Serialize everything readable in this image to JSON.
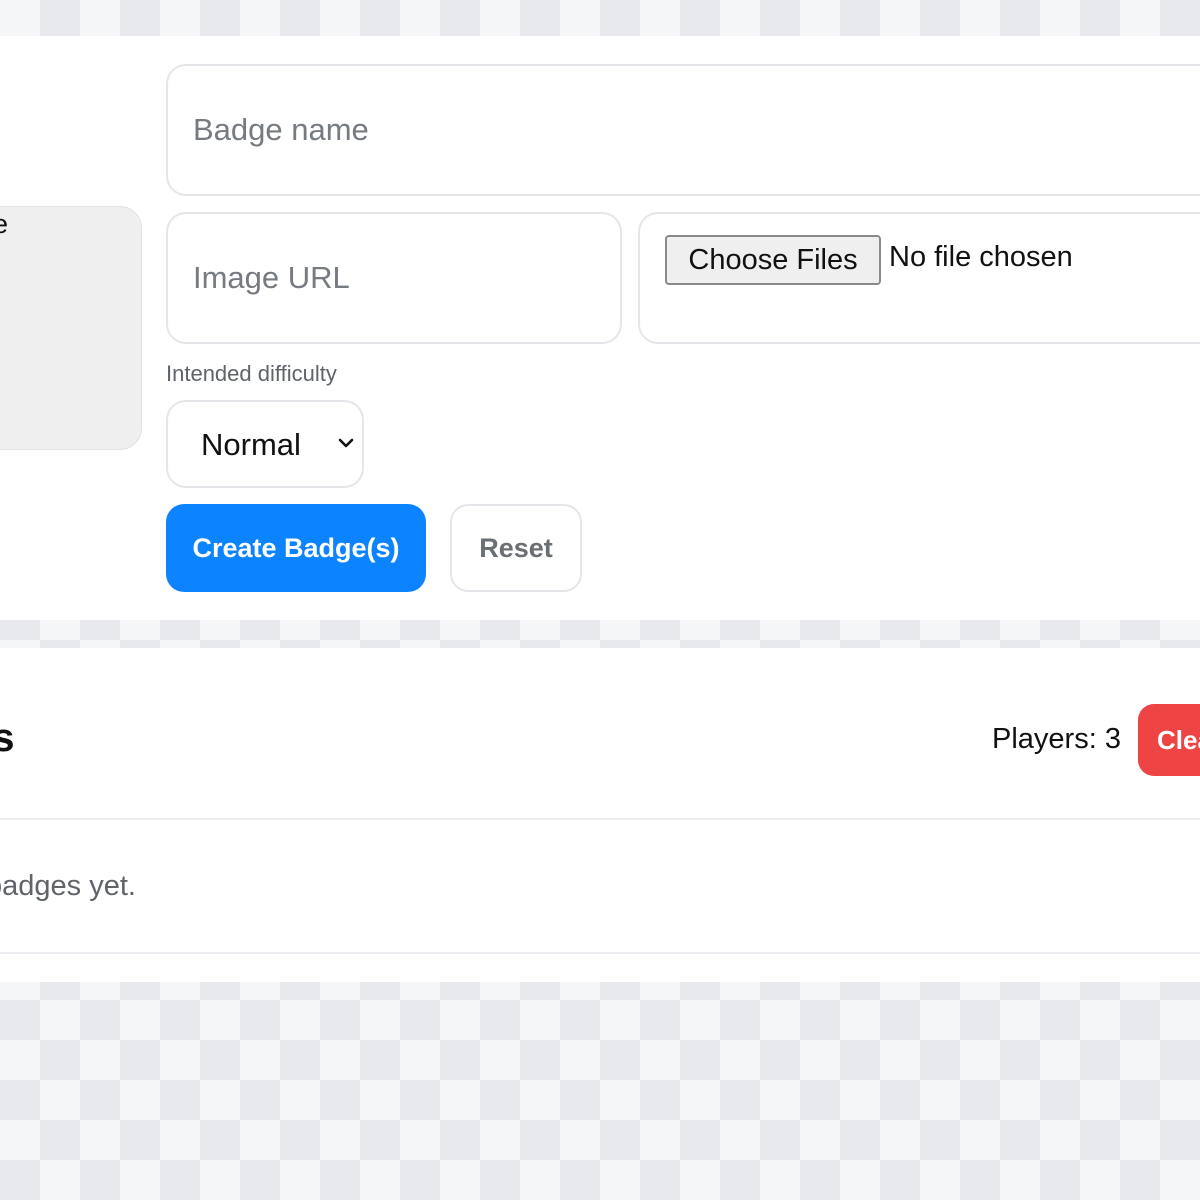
{
  "badge_form": {
    "preview_text": "e",
    "badge_name_placeholder": "Badge name",
    "image_url_placeholder": "Image URL",
    "file_button_label": "Choose Files",
    "file_status": "No file chosen",
    "difficulty_label": "Intended difficulty",
    "difficulty_selected": "Normal",
    "create_button_label": "Create Badge(s)",
    "reset_button_label": "Reset"
  },
  "badges_list": {
    "title_fragment": "es",
    "players_count": "Players: 3",
    "clear_button_label": "Clea",
    "empty_message_fragment": "badges yet."
  },
  "colors": {
    "primary": "#0d84ff",
    "danger": "#ef4444",
    "border": "#e4e6ea",
    "muted_text": "#5f646b"
  }
}
